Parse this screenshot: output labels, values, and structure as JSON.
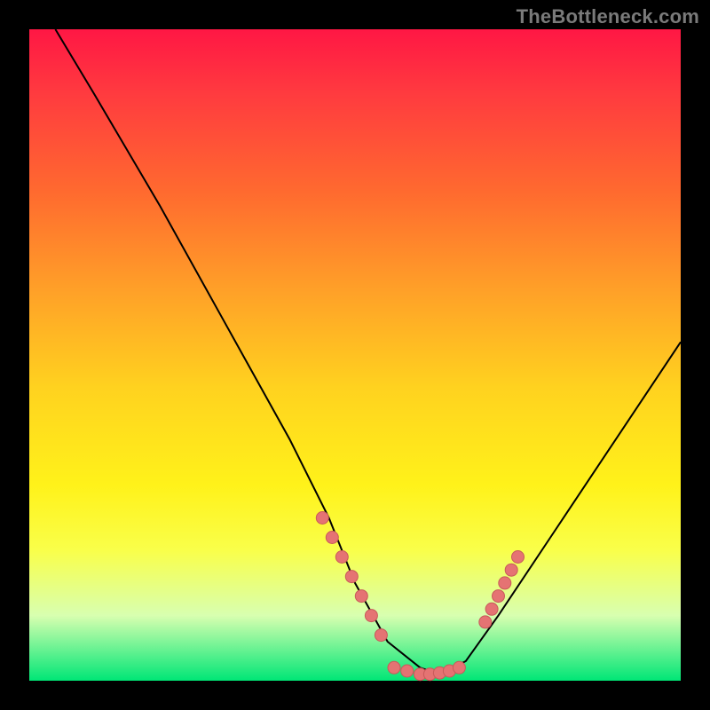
{
  "watermark": "TheBottleneck.com",
  "colors": {
    "dot_fill": "#e57373",
    "dot_stroke": "#c85a5a",
    "line": "#000000"
  },
  "chart_data": {
    "type": "line",
    "title": "",
    "xlabel": "",
    "ylabel": "",
    "xlim": [
      0,
      100
    ],
    "ylim": [
      0,
      100
    ],
    "series": [
      {
        "name": "curve",
        "x": [
          4,
          10,
          20,
          30,
          40,
          46,
          50,
          55,
          60,
          63,
          67,
          72,
          80,
          90,
          100
        ],
        "y": [
          100,
          90,
          73,
          55,
          37,
          25,
          15,
          6,
          2,
          1,
          3,
          10,
          22,
          37,
          52
        ]
      }
    ],
    "markers": {
      "left_cluster": {
        "x": [
          45,
          46.5,
          48,
          49.5,
          51,
          52.5,
          54
        ],
        "y": [
          25,
          22,
          19,
          16,
          13,
          10,
          7
        ]
      },
      "bottom_cluster": {
        "x": [
          56,
          58,
          60,
          61.5,
          63,
          64.5,
          66
        ],
        "y": [
          2,
          1.5,
          1,
          1,
          1.2,
          1.5,
          2
        ]
      },
      "right_cluster": {
        "x": [
          70,
          71,
          72,
          73,
          74,
          75
        ],
        "y": [
          9,
          11,
          13,
          15,
          17,
          19
        ]
      }
    }
  }
}
